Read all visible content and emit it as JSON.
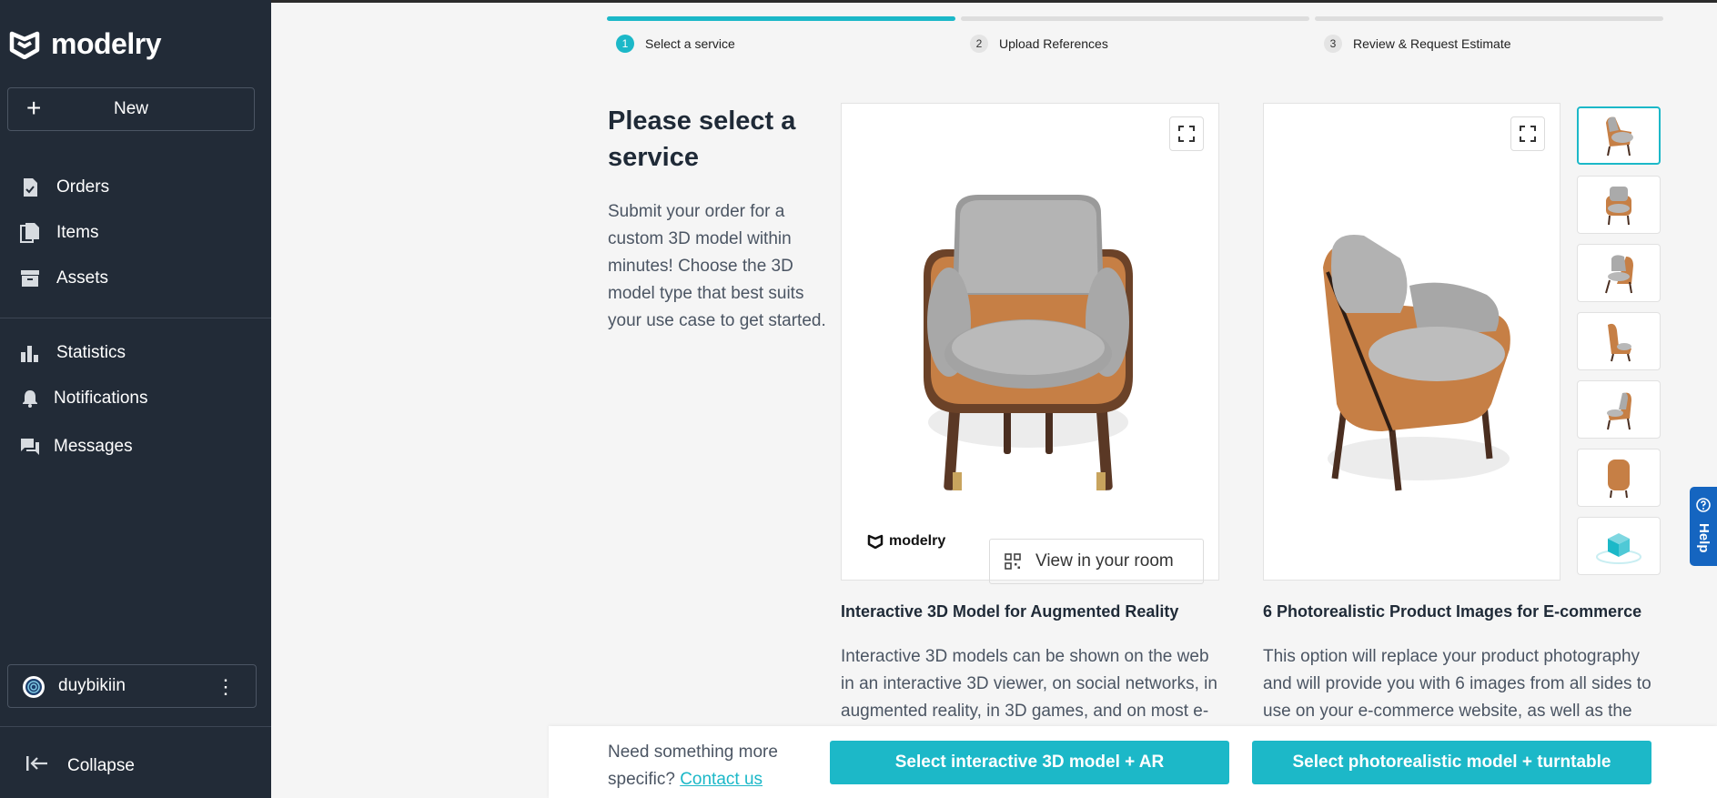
{
  "brand": {
    "name": "modelry",
    "accent": "#1cb8c8",
    "sidebar_bg": "#222b37",
    "help_bg": "#1565c0"
  },
  "sidebar": {
    "new_label": "New",
    "items": [
      {
        "label": "Orders",
        "icon": "file-check-icon"
      },
      {
        "label": "Items",
        "icon": "files-icon"
      },
      {
        "label": "Assets",
        "icon": "archive-icon"
      },
      {
        "label": "Statistics",
        "icon": "bar-chart-icon"
      },
      {
        "label": "Notifications",
        "icon": "bell-icon"
      },
      {
        "label": "Messages",
        "icon": "chat-icon"
      }
    ],
    "user": {
      "name": "duybikiin"
    },
    "collapse_label": "Collapse"
  },
  "stepper": {
    "steps": [
      {
        "num": "1",
        "label": "Select a service",
        "active": true
      },
      {
        "num": "2",
        "label": "Upload References",
        "active": false
      },
      {
        "num": "3",
        "label": "Review & Request Estimate",
        "active": false
      }
    ]
  },
  "intro": {
    "title": "Please select a service",
    "text": "Submit your order for a custom 3D model within minutes! Choose the 3D model type that best suits your use case to get started."
  },
  "services": [
    {
      "title": "Interactive 3D Model for Augmented Reality",
      "description": "Interactive 3D models can be shown on the web in an interactive 3D viewer,  on social networks, in augmented reality, in 3D games, and on most e-",
      "brand_label": "modelry",
      "view_room_label": "View in your room"
    },
    {
      "title": "6 Photorealistic Product Images for E-commerce",
      "description": "This option will replace your product photography and will provide you with 6 images from all sides to use on your e-commerce website, as well as the"
    }
  ],
  "help_label": "Help",
  "bottom": {
    "prompt": "Need something more specific?",
    "contact_label": "Contact us",
    "btn_3d": "Select interactive 3D model + AR",
    "btn_photo": "Select photorealistic model + turntable"
  }
}
